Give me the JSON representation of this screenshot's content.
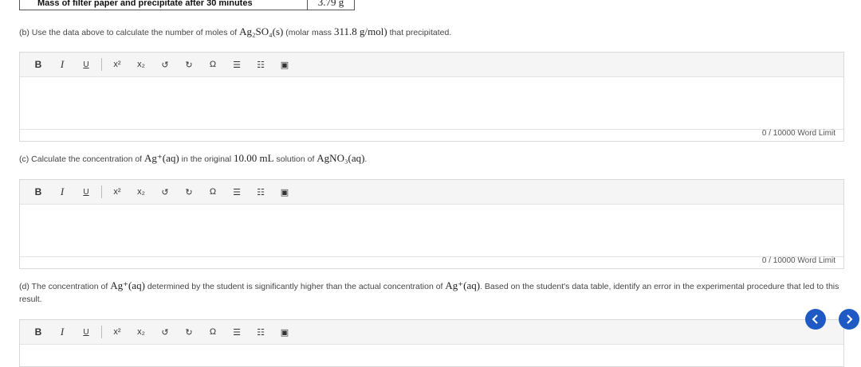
{
  "data_table": {
    "label": "Mass of filter paper and precipitate after 30 minutes",
    "value": "3.79 g"
  },
  "questions": {
    "b": {
      "prefix": "(b) Use the data above to calculate the number of moles of",
      "formula": "Ag₂SO₄(s)",
      "middle": "(molar mass",
      "mass": "311.8 g/mol)",
      "suffix": "that precipitated."
    },
    "c": {
      "prefix": "(c) Calculate the concentration of",
      "ion": "Ag⁺(aq)",
      "middle": "in the original",
      "volume": "10.00 mL",
      "middle2": "solution of",
      "compound": "AgNO₃(aq)",
      "end": "."
    },
    "d": {
      "prefix": "(d) The concentration of",
      "ion1": "Ag⁺(aq)",
      "middle": "determined by the student is significantly higher than the actual concentration of",
      "ion2": "Ag⁺(aq)",
      "suffix": ". Based on the student's data table, identify an error in the experimental procedure that led to this result."
    }
  },
  "toolbar": {
    "bold": "B",
    "italic": "I",
    "underline": "U",
    "superscript": "x²",
    "subscript": "x₂",
    "undo": "↺",
    "redo": "↻",
    "omega": "Ω",
    "bullets": "☰",
    "numbered": "☷",
    "image": "▣"
  },
  "editors": {
    "b_word_limit": "0 / 10000 Word Limit",
    "c_word_limit": "0 / 10000 Word Limit"
  },
  "nav": {
    "prev": "‹",
    "next": "›"
  },
  "colors": {
    "accent": "#1f5ac4"
  }
}
